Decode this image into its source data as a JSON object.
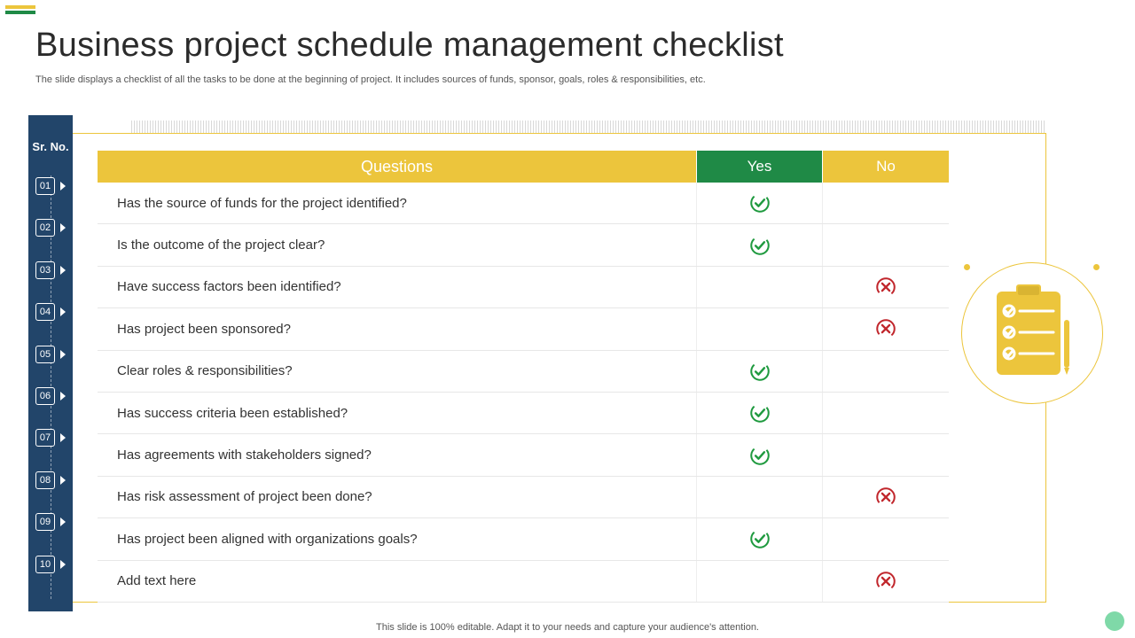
{
  "title": "Business project schedule management checklist",
  "subtitle": "The slide displays a checklist of all the tasks to be done at the beginning of project. It includes sources of funds, sponsor, goals, roles & responsibilities, etc.",
  "srno_label": "Sr. No.",
  "headers": {
    "q": "Questions",
    "y": "Yes",
    "n": "No"
  },
  "rows": [
    {
      "n": "01",
      "q": "Has the source of funds for the project identified?",
      "ans": "yes"
    },
    {
      "n": "02",
      "q": "Is the outcome of the project clear?",
      "ans": "yes"
    },
    {
      "n": "03",
      "q": "Have success factors been identified?",
      "ans": "no"
    },
    {
      "n": "04",
      "q": "Has project been sponsored?",
      "ans": "no"
    },
    {
      "n": "05",
      "q": "Clear roles & responsibilities?",
      "ans": "yes"
    },
    {
      "n": "06",
      "q": "Has success criteria been established?",
      "ans": "yes"
    },
    {
      "n": "07",
      "q": "Has agreements with stakeholders signed?",
      "ans": "yes"
    },
    {
      "n": "08",
      "q": "Has risk assessment of project been done?",
      "ans": "no"
    },
    {
      "n": "09",
      "q": "Has project been aligned with organizations goals?",
      "ans": "yes"
    },
    {
      "n": "10",
      "q": "Add text here",
      "ans": "no"
    }
  ],
  "footnote": "This slide is 100% editable. Adapt it to your needs and capture your audience's attention.",
  "colors": {
    "navy": "#22456a",
    "gold": "#ecc53c",
    "green": "#1f8a46",
    "red": "#c1272d",
    "tick": "#1f9a3f"
  }
}
